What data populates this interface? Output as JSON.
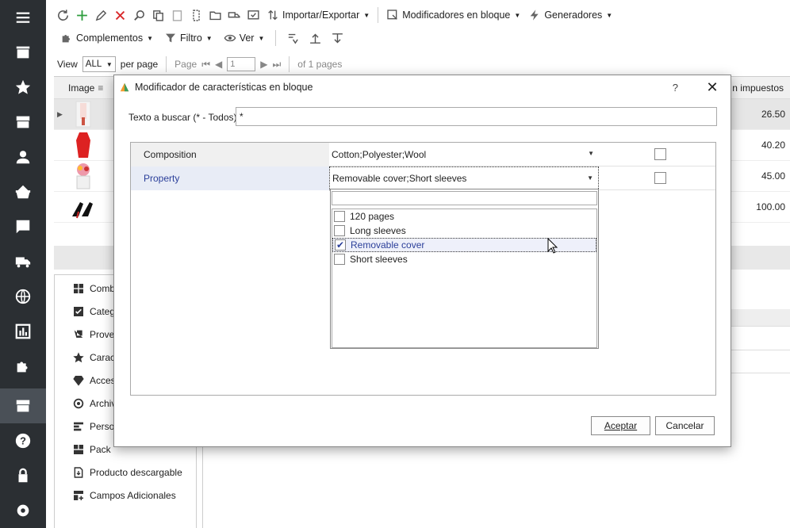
{
  "sidebar": {
    "items": [
      {
        "icon": "menu-icon"
      },
      {
        "icon": "store-icon"
      },
      {
        "icon": "star-icon"
      },
      {
        "icon": "archive-icon"
      },
      {
        "icon": "user-icon"
      },
      {
        "icon": "basket-icon"
      },
      {
        "icon": "chat-icon"
      },
      {
        "icon": "truck-icon"
      },
      {
        "icon": "globe-icon"
      },
      {
        "icon": "chart-icon"
      },
      {
        "icon": "puzzle-icon"
      },
      {
        "icon": "archive-box-icon"
      },
      {
        "icon": "help-icon"
      },
      {
        "icon": "lock-icon"
      },
      {
        "icon": "settings-icon"
      }
    ]
  },
  "toolbar": {
    "import_export": "Importar/Exportar",
    "bulk_modifiers": "Modificadores en bloque",
    "generators": "Generadores",
    "complements": "Complementos",
    "filter": "Filtro",
    "view": "Ver"
  },
  "pager": {
    "view_label": "View",
    "view_value": "ALL",
    "per_page": "per page",
    "page_label": "Page",
    "page_value": "1",
    "of_pages": "of 1 pages"
  },
  "grid": {
    "col_image": "Image",
    "col_price": "n impuestos",
    "rows": [
      {
        "price": "26.50"
      },
      {
        "price": "40.20"
      },
      {
        "price": "45.00"
      },
      {
        "price": "100.00"
      }
    ]
  },
  "lower_panel": {
    "items": [
      {
        "label": "Comb",
        "icon": "combinations-icon"
      },
      {
        "label": "Categ",
        "icon": "categories-check-icon"
      },
      {
        "label": "Prove",
        "icon": "supplier-icon"
      },
      {
        "label": "Caract",
        "icon": "star-icon"
      },
      {
        "label": "Acces",
        "icon": "diamond-icon"
      },
      {
        "label": "Archiv",
        "icon": "attachment-icon"
      },
      {
        "label": "Perso",
        "icon": "customization-icon"
      },
      {
        "label": "Pack",
        "icon": "pack-icon"
      },
      {
        "label": "Producto descargable",
        "icon": "download-icon"
      },
      {
        "label": "Campos Adicionales",
        "icon": "extra-fields-icon"
      }
    ]
  },
  "dialog": {
    "title": "Modificador de características en bloque",
    "help": "?",
    "search_label": "Texto a buscar (* - Todos)",
    "search_value": "*",
    "properties": [
      {
        "name": "Composition",
        "value": "Cotton;Polyester;Wool"
      },
      {
        "name": "Property",
        "value": "Removable cover;Short sleeves"
      }
    ],
    "options": [
      {
        "label": "120 pages",
        "checked": false
      },
      {
        "label": "Long sleeves",
        "checked": false
      },
      {
        "label": "Removable cover",
        "checked": true
      },
      {
        "label": "Short sleeves",
        "checked": false
      }
    ],
    "accept": "Aceptar",
    "cancel": "Cancelar"
  },
  "colors": {
    "sidebar_bg": "#2b2f33",
    "accent_link": "#2b3f9a",
    "add_green": "#2e9e3e",
    "delete_red": "#d9292b"
  }
}
